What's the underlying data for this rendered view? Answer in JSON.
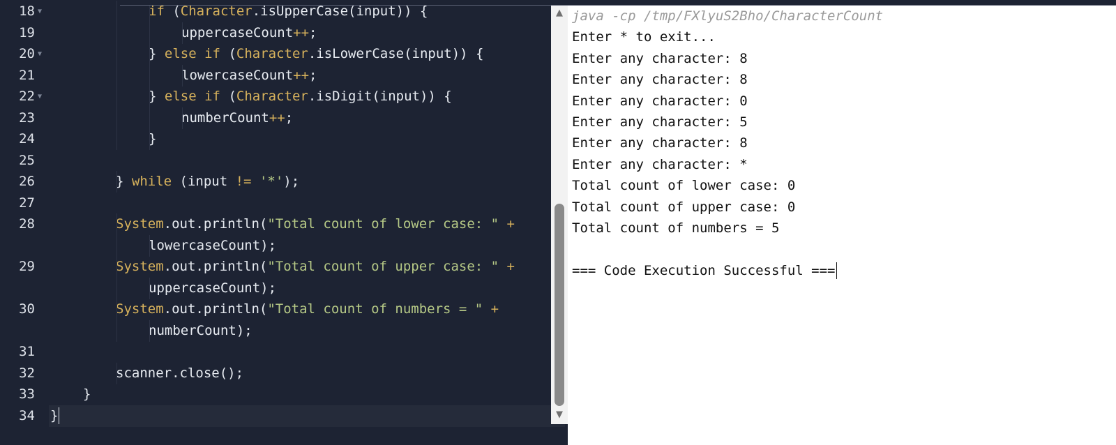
{
  "editor": {
    "lines": [
      {
        "no": "18",
        "fold": true,
        "indent": 4,
        "parts": [
          {
            "t": "if",
            "c": "kw"
          },
          {
            "t": " ("
          },
          {
            "t": "Character",
            "c": "cls"
          },
          {
            "t": ".isUpperCase(input)) {"
          }
        ]
      },
      {
        "no": "19",
        "fold": false,
        "indent": 5,
        "parts": [
          {
            "t": "uppercaseCount"
          },
          {
            "t": "++",
            "c": "op"
          },
          {
            "t": ";"
          }
        ]
      },
      {
        "no": "20",
        "fold": true,
        "indent": 4,
        "parts": [
          {
            "t": "} "
          },
          {
            "t": "else",
            "c": "kw"
          },
          {
            "t": " "
          },
          {
            "t": "if",
            "c": "kw"
          },
          {
            "t": " ("
          },
          {
            "t": "Character",
            "c": "cls"
          },
          {
            "t": ".isLowerCase(input)) {"
          }
        ]
      },
      {
        "no": "21",
        "fold": false,
        "indent": 5,
        "parts": [
          {
            "t": "lowercaseCount"
          },
          {
            "t": "++",
            "c": "op"
          },
          {
            "t": ";"
          }
        ]
      },
      {
        "no": "22",
        "fold": true,
        "indent": 4,
        "parts": [
          {
            "t": "} "
          },
          {
            "t": "else",
            "c": "kw"
          },
          {
            "t": " "
          },
          {
            "t": "if",
            "c": "kw"
          },
          {
            "t": " ("
          },
          {
            "t": "Character",
            "c": "cls"
          },
          {
            "t": ".isDigit(input)) {"
          }
        ]
      },
      {
        "no": "23",
        "fold": false,
        "indent": 5,
        "parts": [
          {
            "t": "numberCount"
          },
          {
            "t": "++",
            "c": "op"
          },
          {
            "t": ";"
          }
        ]
      },
      {
        "no": "24",
        "fold": false,
        "indent": 4,
        "parts": [
          {
            "t": "}"
          }
        ]
      },
      {
        "no": "25",
        "fold": false,
        "indent": 0,
        "parts": []
      },
      {
        "no": "26",
        "fold": false,
        "indent": 3,
        "parts": [
          {
            "t": "} "
          },
          {
            "t": "while",
            "c": "kw"
          },
          {
            "t": " (input "
          },
          {
            "t": "!=",
            "c": "op"
          },
          {
            "t": " "
          },
          {
            "t": "'*'",
            "c": "str"
          },
          {
            "t": ");"
          }
        ]
      },
      {
        "no": "27",
        "fold": false,
        "indent": 0,
        "parts": []
      },
      {
        "no": "28",
        "fold": false,
        "indent": 3,
        "parts": [
          {
            "t": "System",
            "c": "cls"
          },
          {
            "t": ".out.println("
          },
          {
            "t": "\"Total count of lower case: \"",
            "c": "str"
          },
          {
            "t": " "
          },
          {
            "t": "+",
            "c": "op"
          }
        ]
      },
      {
        "no": "",
        "fold": false,
        "indent": 4,
        "parts": [
          {
            "t": "lowercaseCount);"
          }
        ]
      },
      {
        "no": "29",
        "fold": false,
        "indent": 3,
        "parts": [
          {
            "t": "System",
            "c": "cls"
          },
          {
            "t": ".out.println("
          },
          {
            "t": "\"Total count of upper case: \"",
            "c": "str"
          },
          {
            "t": " "
          },
          {
            "t": "+",
            "c": "op"
          }
        ]
      },
      {
        "no": "",
        "fold": false,
        "indent": 4,
        "parts": [
          {
            "t": "uppercaseCount);"
          }
        ]
      },
      {
        "no": "30",
        "fold": false,
        "indent": 3,
        "parts": [
          {
            "t": "System",
            "c": "cls"
          },
          {
            "t": ".out.println("
          },
          {
            "t": "\"Total count of numbers = \"",
            "c": "str"
          },
          {
            "t": " "
          },
          {
            "t": "+",
            "c": "op"
          }
        ]
      },
      {
        "no": "",
        "fold": false,
        "indent": 4,
        "parts": [
          {
            "t": "numberCount);"
          }
        ]
      },
      {
        "no": "31",
        "fold": false,
        "indent": 0,
        "parts": []
      },
      {
        "no": "32",
        "fold": false,
        "indent": 3,
        "parts": [
          {
            "t": "scanner.close();"
          }
        ]
      },
      {
        "no": "33",
        "fold": false,
        "indent": 2,
        "parts": [
          {
            "t": "}"
          }
        ]
      },
      {
        "no": "34",
        "fold": false,
        "indent": 1,
        "active": true,
        "cursor": true,
        "parts": [
          {
            "t": "}"
          }
        ]
      }
    ]
  },
  "terminal": {
    "command": "java -cp /tmp/FXlyuS2Bho/CharacterCount",
    "output": [
      "Enter * to exit...",
      "Enter any character: 8",
      "Enter any character: 8",
      "Enter any character: 0",
      "Enter any character: 5",
      "Enter any character: 8",
      "Enter any character: *",
      "Total count of lower case: 0",
      "Total count of upper case: 0",
      "Total count of numbers = 5",
      "",
      "=== Code Execution Successful ==="
    ]
  },
  "scrollbar": {
    "up_icon": "triangle-up-icon",
    "down_icon": "triangle-down-icon"
  }
}
